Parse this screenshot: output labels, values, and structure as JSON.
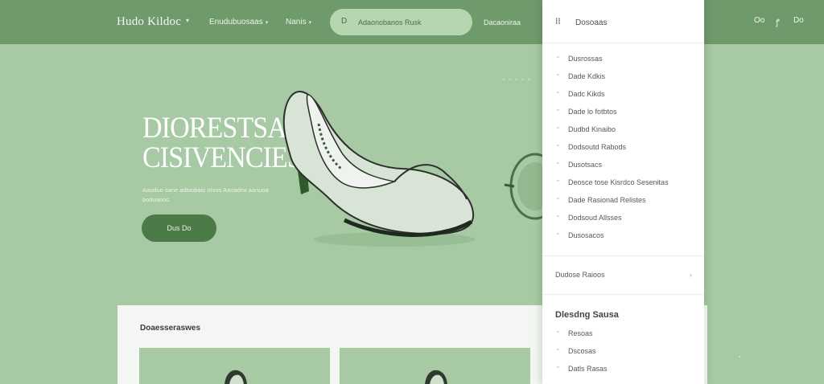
{
  "header": {
    "brand": "Hudo Kildoc",
    "nav": [
      {
        "label": "Enudubuosaas"
      },
      {
        "label": "Nanis"
      }
    ],
    "search": {
      "placeholder": "Adaonobanos Rusk"
    },
    "link": "Dacaoniraa",
    "icons": [
      {
        "name": "user-icon",
        "glyph": "Oo"
      },
      {
        "name": "heart-icon",
        "glyph": "ꝭ"
      },
      {
        "name": "cart-icon",
        "glyph": "Do"
      }
    ]
  },
  "hero": {
    "title_line1": "DIORESTSAI",
    "title_line2": "CISIVENCIES",
    "subtitle": "Aaoduo sane adsiobaio onnis Aanadrw aanuoa boduaoos",
    "cta": "Dus Do",
    "dots": "• • • • •"
  },
  "products": {
    "title": "Doaesseraswes"
  },
  "menu": {
    "title": "Dosoaas",
    "items": [
      {
        "label": "Dusrossas"
      },
      {
        "label": "Dade Kdkis"
      },
      {
        "label": "Dadc Kikds"
      },
      {
        "label": "Dade lo fotbtos"
      },
      {
        "label": "Dudbd Kinaibo"
      },
      {
        "label": "Dodsoutd Rabods"
      },
      {
        "label": "Dusotsacs"
      },
      {
        "label": "Deosce tose Kisrdco Sesenitas"
      },
      {
        "label": "Dade Rasionad Relistes"
      },
      {
        "label": "Dodsoud Allsses"
      },
      {
        "label": "Dusosacos"
      }
    ],
    "section": "Dudose Raioos",
    "group_title": "Dlesdng Sausa",
    "group_items": [
      {
        "label": "Resoas"
      },
      {
        "label": "Dscosas"
      },
      {
        "label": "Datls Rasas"
      }
    ]
  },
  "colors": {
    "topbar": "#6f9a6c",
    "background": "#a7c9a4",
    "cta": "#4c7b48",
    "menu_bg": "#ffffff"
  }
}
